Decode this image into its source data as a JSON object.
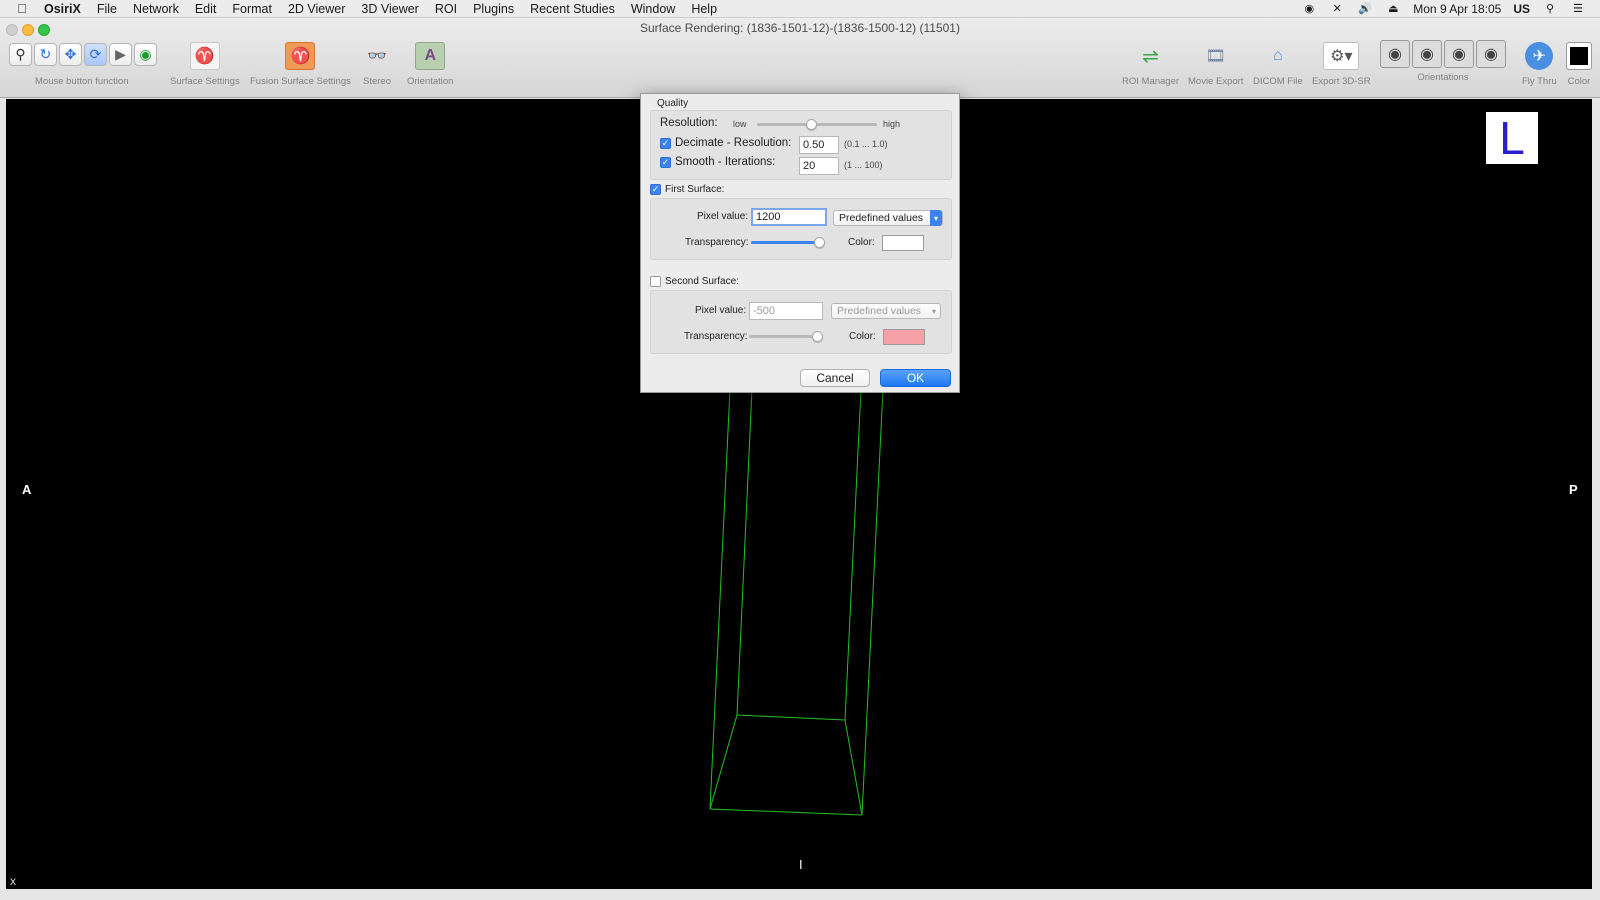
{
  "menubar": {
    "app": "OsiriX",
    "items": [
      "File",
      "Network",
      "Edit",
      "Format",
      "2D Viewer",
      "3D Viewer",
      "ROI",
      "Plugins",
      "Recent Studies",
      "Window",
      "Help"
    ],
    "datetime": "Mon 9 Apr  18:05",
    "input_source": "US"
  },
  "window": {
    "title": "Surface Rendering: (1836-1501-12)-(1836-1500-12) (11501)"
  },
  "toolbar": {
    "mouse_function_label": "Mouse button function",
    "surface_settings": "Surface Settings",
    "fusion_surface_settings": "Fusion Surface Settings",
    "stereo": "Stereo",
    "orientation": "Orientation",
    "roi_manager": "ROI Manager",
    "movie_export": "Movie Export",
    "dicom_file": "DICOM File",
    "export_3dsr": "Export 3D-SR",
    "orientations": "Orientations",
    "fly_thru": "Fly Thru",
    "color": "Color"
  },
  "viewer": {
    "left_label": "A",
    "right_label": "P",
    "bottom_label": "I",
    "marker_letter": "L",
    "corner_label": "X"
  },
  "dialog": {
    "quality_title": "Quality",
    "resolution_label": "Resolution:",
    "low_label": "low",
    "high_label": "high",
    "resolution_level": 0.45,
    "decimate": {
      "label": "Decimate - Resolution:",
      "checked": true,
      "value": "0.50",
      "hint": "(0.1 ... 1.0)"
    },
    "smooth": {
      "label": "Smooth - Iterations:",
      "checked": true,
      "value": "20",
      "hint": "(1 ... 100)"
    },
    "first_surface": {
      "label": "First Surface:",
      "checked": true,
      "pixel_label": "Pixel value:",
      "pixel_value": "1200",
      "predefined": "Predefined values",
      "transparency_label": "Transparency:",
      "transparency_level": 1.0,
      "color_label": "Color:",
      "color": "#ffffff"
    },
    "second_surface": {
      "label": "Second Surface:",
      "checked": false,
      "pixel_label": "Pixel value:",
      "pixel_value": "-500",
      "predefined": "Predefined values",
      "transparency_label": "Transparency:",
      "transparency_level": 1.0,
      "color_label": "Color:",
      "color": "#f4a0a6"
    },
    "cancel": "Cancel",
    "ok": "OK"
  },
  "colors": {
    "accent": "#3b84ef",
    "wireframe": "#22c322",
    "marker_letter": "#2a1fc9"
  }
}
